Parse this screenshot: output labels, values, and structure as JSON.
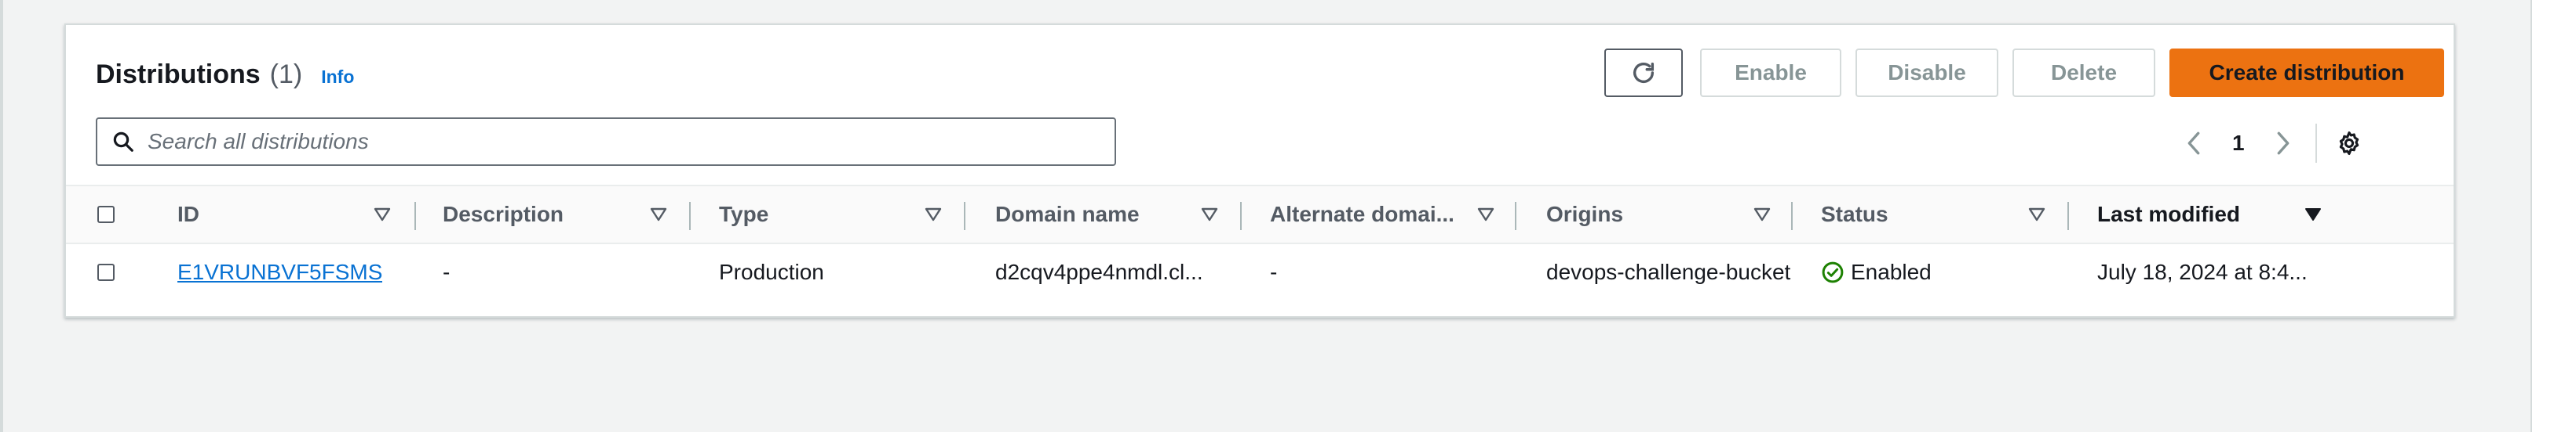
{
  "header": {
    "title": "Distributions",
    "count": "(1)",
    "info": "Info"
  },
  "buttons": {
    "enable": "Enable",
    "disable": "Disable",
    "delete": "Delete",
    "create": "Create distribution"
  },
  "search": {
    "placeholder": "Search all distributions"
  },
  "pagination": {
    "current_page": "1"
  },
  "columns": [
    "ID",
    "Description",
    "Type",
    "Domain name",
    "Alternate domai...",
    "Origins",
    "Status",
    "Last modified"
  ],
  "rows": [
    {
      "id": "E1VRUNBVF5FSMS",
      "description": "-",
      "type": "Production",
      "domain": "d2cqv4ppe4nmdl.cl...",
      "alternate": "-",
      "origins": "devops-challenge-bucket-",
      "status": "Enabled",
      "last_modified": "July 18, 2024 at 8:4..."
    }
  ],
  "colors": {
    "primary": "#ec7211",
    "link": "#0972d3",
    "success": "#1d8102",
    "disabled_text": "#879596"
  },
  "icons": [
    "refresh-icon",
    "search-icon",
    "chevron-left-icon",
    "chevron-right-icon",
    "settings-icon",
    "sort-icon",
    "sort-desc-icon",
    "check-circle-icon"
  ]
}
